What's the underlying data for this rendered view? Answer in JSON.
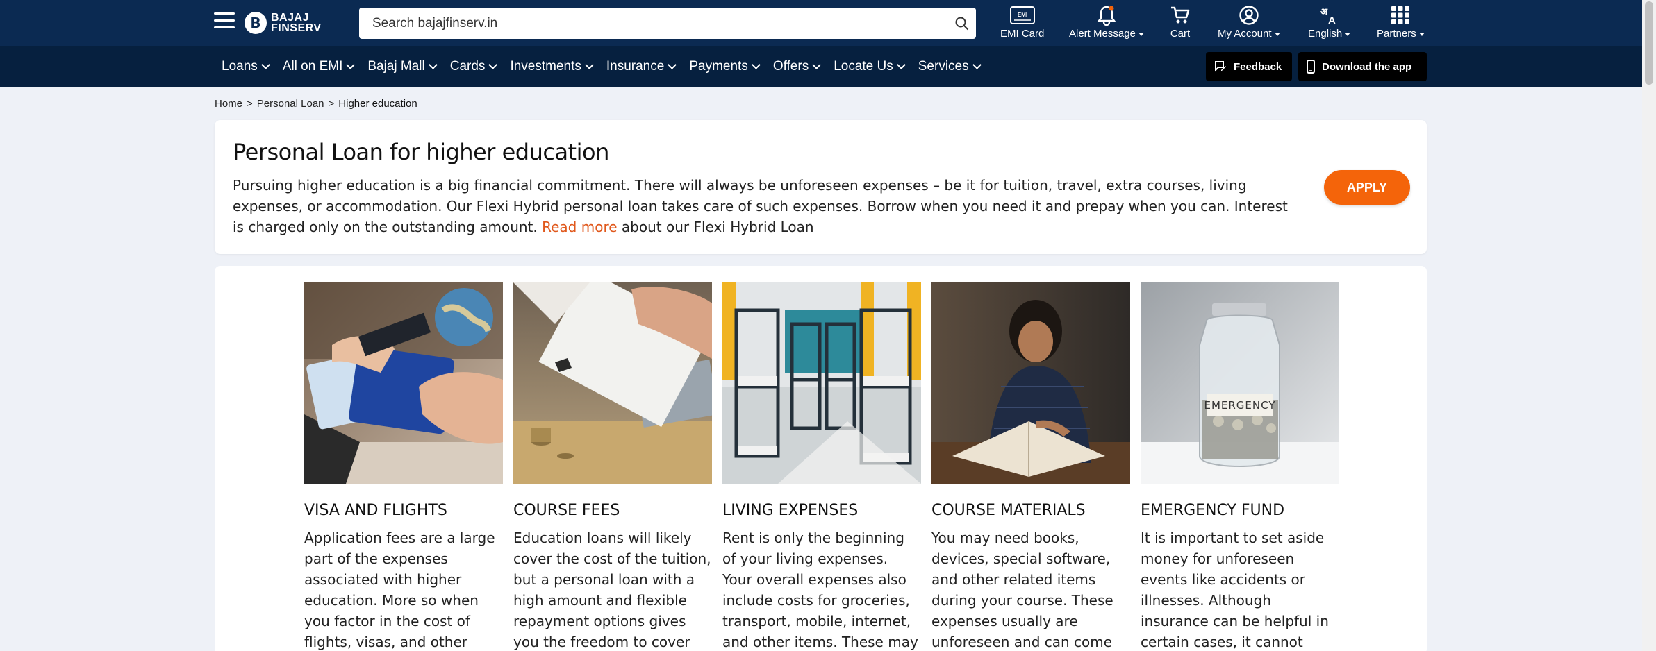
{
  "header": {
    "logo_text_line1": "BAJAJ",
    "logo_text_line2": "FINSERV",
    "logo_mark": "B",
    "search_placeholder": "Search bajajfinserv.in",
    "tools": [
      {
        "label": "EMI Card",
        "icon": "emi-card-icon",
        "badge": "EMI"
      },
      {
        "label": "Alert Message",
        "icon": "bell-icon"
      },
      {
        "label": "Cart",
        "icon": "cart-icon"
      },
      {
        "label": "My Account",
        "icon": "user-icon"
      },
      {
        "label": "English",
        "icon": "language-icon"
      },
      {
        "label": "Partners",
        "icon": "grid-icon"
      }
    ]
  },
  "nav": {
    "items": [
      "Loans",
      "All on EMI",
      "Bajaj Mall",
      "Cards",
      "Investments",
      "Insurance",
      "Payments",
      "Offers",
      "Locate Us",
      "Services"
    ],
    "feedback": "Feedback",
    "download": "Download the app"
  },
  "breadcrumb": {
    "home": "Home",
    "personal_loan": "Personal Loan",
    "current": "Higher education",
    "sep": ">"
  },
  "intro": {
    "title": "Personal Loan for higher education",
    "body": "Pursuing higher education is a big financial commitment. There will always be unforeseen expenses – be it for tuition, travel, extra courses, living expenses, or accommodation. Our Flexi Hybrid personal loan takes care of such expenses. Borrow when you need it and prepay when you can. Interest is charged only on the outstanding amount. ",
    "read_more": "Read more",
    "after_link": " about our Flexi Hybrid Loan",
    "apply": "APPLY"
  },
  "tiles": [
    {
      "title": "VISA AND FLIGHTS",
      "text": "Application fees are a large part of the expenses associated with higher education. More so when you factor in the cost of flights, visas, and other paperwork"
    },
    {
      "title": "COURSE FEES",
      "text": "Education loans will likely cover the cost of the tuition, but a personal loan with a high amount and flexible repayment options gives you the freedom to cover"
    },
    {
      "title": "LIVING EXPENSES",
      "text": "Rent is only the beginning of your living expenses. Your overall expenses also include costs for groceries, transport, mobile, internet, and other items. These may set you back"
    },
    {
      "title": "COURSE MATERIALS",
      "text": "You may need books, devices, special software, and other related items during your course. These expenses usually are unforeseen and can come as an ad-hoc"
    },
    {
      "title": "EMERGENCY FUND",
      "text": "It is important to set aside money for unforeseen events like accidents or illnesses. Although insurance can be helpful in certain cases, it cannot always cover every",
      "jar_label": "EMERGENCY"
    }
  ],
  "colors": {
    "header_bg": "#0b2a52",
    "nav_bg": "#06203f",
    "accent": "#f4640a",
    "link": "#e0581c"
  }
}
